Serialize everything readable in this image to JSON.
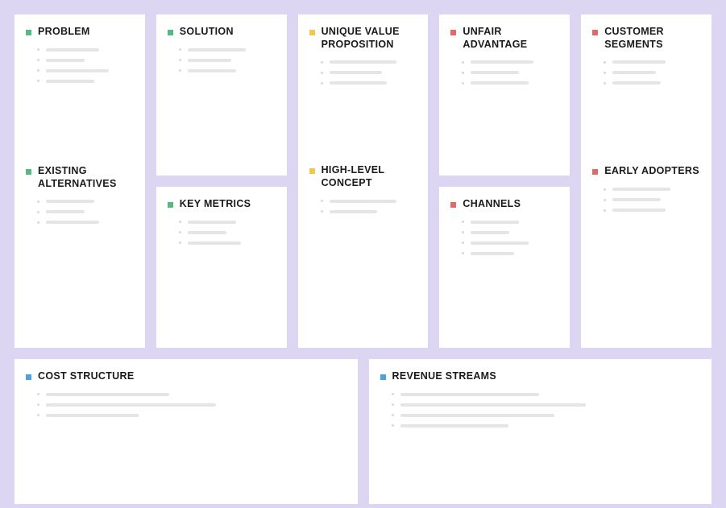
{
  "colors": {
    "green": "#57b884",
    "yellow": "#f2c84b",
    "red": "#e06a6a",
    "blue": "#4aa3e0"
  },
  "sections": {
    "problem": {
      "title": "PROBLEM",
      "marker": "green",
      "placeholder_lines": 4
    },
    "existing_alternatives": {
      "title": "EXISTING ALTERNATIVES",
      "marker": "green",
      "placeholder_lines": 3
    },
    "solution": {
      "title": "SOLUTION",
      "marker": "green",
      "placeholder_lines": 3
    },
    "key_metrics": {
      "title": "KEY METRICS",
      "marker": "green",
      "placeholder_lines": 3
    },
    "unique_value_proposition": {
      "title": "UNIQUE VALUE PROPOSITION",
      "marker": "yellow",
      "placeholder_lines": 3
    },
    "high_level_concept": {
      "title": "HIGH-LEVEL CONCEPT",
      "marker": "yellow",
      "placeholder_lines": 2
    },
    "unfair_advantage": {
      "title": "UNFAIR ADVANTAGE",
      "marker": "red",
      "placeholder_lines": 3
    },
    "channels": {
      "title": "CHANNELS",
      "marker": "red",
      "placeholder_lines": 4
    },
    "customer_segments": {
      "title": "CUSTOMER SEGMENTS",
      "marker": "red",
      "placeholder_lines": 3
    },
    "early_adopters": {
      "title": "EARLY ADOPTERS",
      "marker": "red",
      "placeholder_lines": 3
    },
    "cost_structure": {
      "title": "COST STRUCTURE",
      "marker": "blue",
      "placeholder_lines": 3
    },
    "revenue_streams": {
      "title": "REVENUE STREAMS",
      "marker": "blue",
      "placeholder_lines": 4
    }
  },
  "placeholder_bar_widths": {
    "problem": [
      55,
      40,
      65,
      50
    ],
    "existing_alternatives": [
      50,
      40,
      55
    ],
    "solution": [
      60,
      45,
      50
    ],
    "key_metrics": [
      50,
      40,
      55
    ],
    "unique_value_proposition": [
      70,
      55,
      60
    ],
    "high_level_concept": [
      70,
      50
    ],
    "unfair_advantage": [
      65,
      50,
      60
    ],
    "channels": [
      50,
      40,
      60,
      45
    ],
    "customer_segments": [
      55,
      45,
      50
    ],
    "early_adopters": [
      60,
      50,
      55
    ],
    "cost_structure": [
      40,
      55,
      30
    ],
    "revenue_streams": [
      45,
      60,
      50,
      35
    ]
  }
}
